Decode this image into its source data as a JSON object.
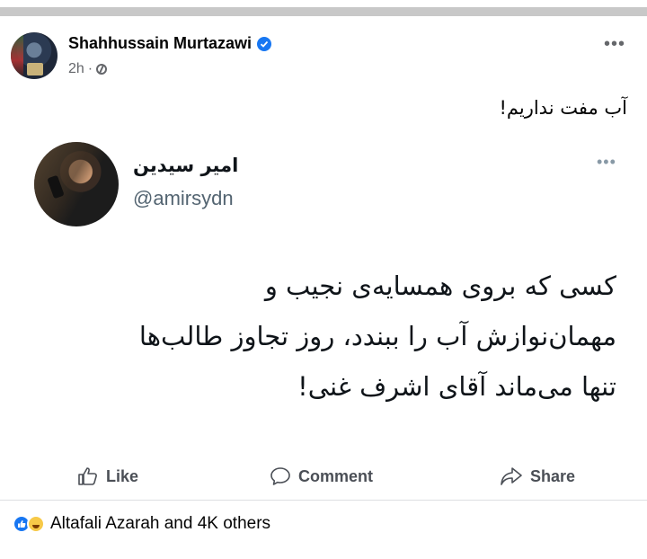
{
  "post": {
    "author": "Shahhussain Murtazawi",
    "time": "2h",
    "separator": "·",
    "caption": "آب مفت نداریم!"
  },
  "tweet": {
    "name": "امیر سیدین",
    "handle": "@amirsydn",
    "lines": [
      "کسی که بروی همسایه‌ی نجیب و",
      "مهمان‌نوازش آب را ببندد، روز تجاوز طالب‌ها",
      "تنها می‌ماند آقای اشرف غنی!"
    ]
  },
  "actions": {
    "like": "Like",
    "comment": "Comment",
    "share": "Share"
  },
  "reactions": {
    "summary": "Altafali Azarah and 4K others",
    "icons": [
      "like-reaction",
      "haha-reaction"
    ]
  },
  "colors": {
    "verified": "#1877f2",
    "muted": "#65676b",
    "divider": "#dddfe2"
  }
}
